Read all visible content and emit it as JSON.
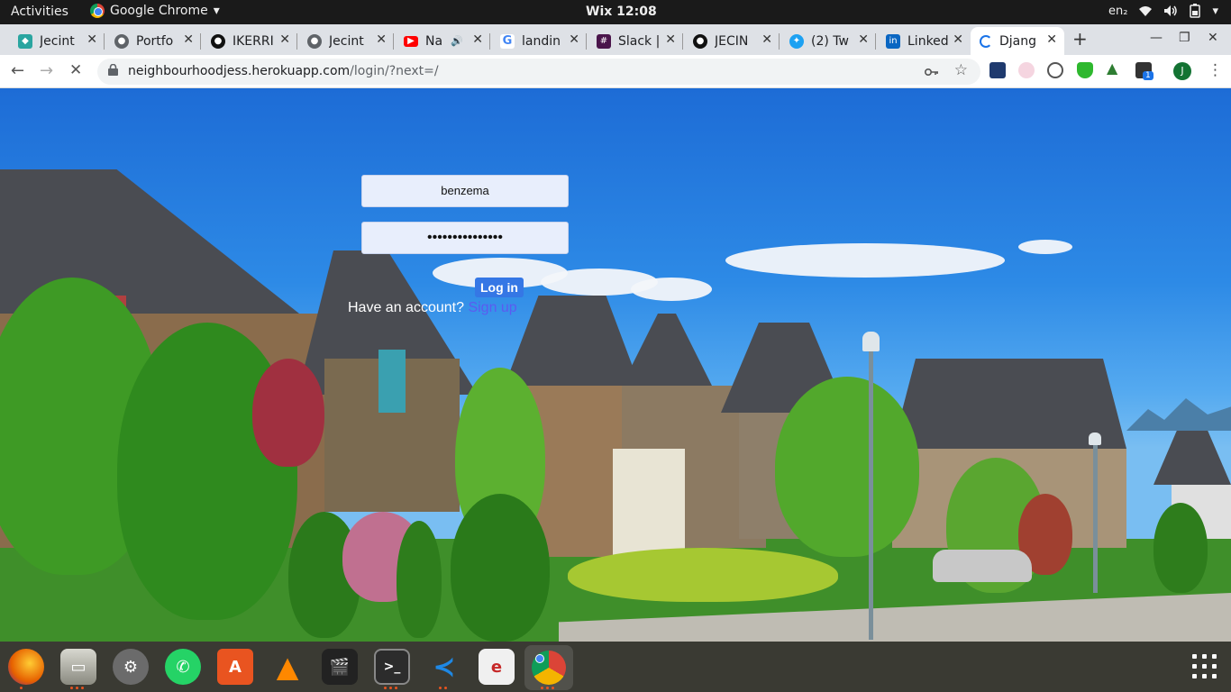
{
  "topbar": {
    "activities": "Activities",
    "app_name": "Google Chrome",
    "app_menu_arrow": "▾",
    "clock": "Wix 12:08",
    "input_method": "en₂",
    "menu_arrow": "▾"
  },
  "tabs": [
    {
      "label": "Jecint",
      "icon": "chrome-web-icon",
      "color": "#4285f4"
    },
    {
      "label": "Portfo",
      "icon": "globe-icon",
      "color": "#5f6368"
    },
    {
      "label": "IKERRI",
      "icon": "github-icon",
      "color": "#111111"
    },
    {
      "label": "Jecint",
      "icon": "globe-icon",
      "color": "#5f6368"
    },
    {
      "label": "Na",
      "icon": "youtube-icon",
      "color": "#ff0000",
      "audio": true
    },
    {
      "label": "landin",
      "icon": "google-icon",
      "color": "#4285f4"
    },
    {
      "label": "Slack |",
      "icon": "slack-icon",
      "color": "#4a154b"
    },
    {
      "label": "JECIN",
      "icon": "github-icon",
      "color": "#111111"
    },
    {
      "label": "(2) Tw",
      "icon": "twitter-icon",
      "color": "#1da1f2"
    },
    {
      "label": "Linked",
      "icon": "linkedin-icon",
      "color": "#0a66c2"
    },
    {
      "label": "Djang",
      "icon": "loading-spinner-icon",
      "color": "#1a73e8",
      "active": true
    }
  ],
  "tab_close": "✕",
  "new_tab": "+",
  "window_controls": {
    "minimize": "—",
    "maximize": "❐",
    "close": "✕"
  },
  "toolbar": {
    "back": "←",
    "forward": "→",
    "stop": "✕",
    "url_host": "neighbourhoodjess.herokuapp.com",
    "url_path": "/login/?next=/",
    "extension_badge": "1",
    "profile_initial": "J",
    "menu": "⋮"
  },
  "login": {
    "username_value": "benzema",
    "password_value": "•••••••••••••••",
    "login_button": "Log in",
    "have_account_text": "Have an account?",
    "signup_link": "Sign up"
  },
  "dock": [
    {
      "name": "firefox",
      "color": "#e66000"
    },
    {
      "name": "files",
      "color": "#8a8a80"
    },
    {
      "name": "settings",
      "color": "#6b6b6b"
    },
    {
      "name": "whatsapp",
      "color": "#25d366"
    },
    {
      "name": "software-center",
      "color": "#e95420"
    },
    {
      "name": "vlc",
      "color": "#ff8800"
    },
    {
      "name": "video-editor",
      "color": "#222222"
    },
    {
      "name": "terminal",
      "color": "#2c2c2c"
    },
    {
      "name": "vscode",
      "color": "#1e88e5"
    },
    {
      "name": "text-editor",
      "color": "#e8e8e8"
    },
    {
      "name": "chrome",
      "color": "#4285f4"
    }
  ]
}
